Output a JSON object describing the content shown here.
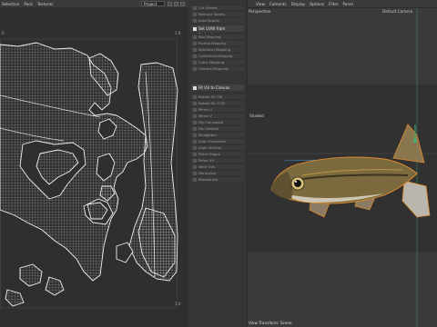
{
  "uv_editor": {
    "menu": [
      "Selection",
      "Pack",
      "Textures"
    ],
    "project_value": "Project",
    "labels": {
      "tl": "0",
      "tr": "1.0",
      "br": "1.0"
    }
  },
  "middle_panel": {
    "group1": [
      "Cut Seams",
      "Remove Seams",
      "Auto Seams"
    ],
    "header1": "Set UVW from Projection",
    "group2": [
      "Box Mapping",
      "Frontal Mapping",
      "Spherical Mapping",
      "Cylindrical Mapping",
      "Cubic Mapping",
      "Camera Mapping"
    ],
    "header2": "Fit UV to Canvas",
    "group3": [
      "Rotate 90 CW",
      "Rotate 90 CCW",
      "Mirror U",
      "Mirror V",
      "Flip Horizontal",
      "Flip Vertical",
      "Straighten",
      "Align Horizontal",
      "Align Vertical",
      "Stitch Edges",
      "Relax UV",
      "Weld UVs",
      "Normalize",
      "Randomize"
    ]
  },
  "viewport": {
    "menu": [
      "View",
      "Cameras",
      "Display",
      "Options",
      "Filter",
      "Panel"
    ],
    "label": "Perspective",
    "camera": "Default Camera",
    "shading": "Shaded",
    "footer": "View Transform: Scene"
  },
  "colors": {
    "uv_lines": "#d8d8d8",
    "fish_outline": "#e08a2c",
    "axis_green": "#3fb37a"
  }
}
